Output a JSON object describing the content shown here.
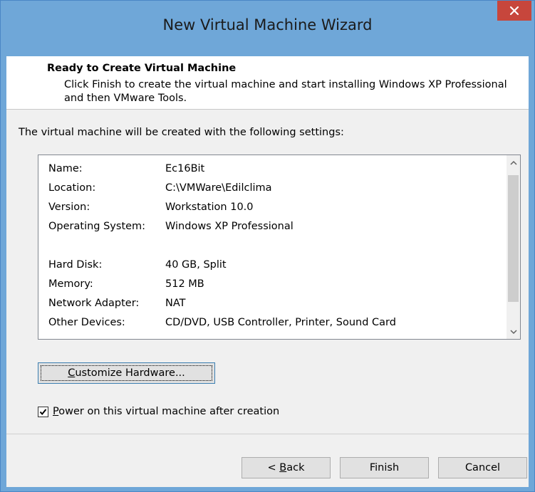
{
  "window": {
    "title": "New Virtual Machine Wizard"
  },
  "header": {
    "title": "Ready to Create Virtual Machine",
    "description": "Click Finish to create the virtual machine and start installing Windows XP Professional and then VMware Tools."
  },
  "intro_text": "The virtual machine will be created with the following settings:",
  "settings": [
    {
      "key": "Name:",
      "value": "Ec16Bit"
    },
    {
      "key": "Location:",
      "value": "C:\\VMWare\\Edilclima"
    },
    {
      "key": "Version:",
      "value": "Workstation 10.0"
    },
    {
      "key": "Operating System:",
      "value": "Windows XP Professional"
    },
    {
      "key": "Hard Disk:",
      "value": "40 GB, Split"
    },
    {
      "key": "Memory:",
      "value": "512 MB"
    },
    {
      "key": "Network Adapter:",
      "value": "NAT"
    },
    {
      "key": "Other Devices:",
      "value": "CD/DVD, USB Controller, Printer, Sound Card"
    }
  ],
  "buttons": {
    "customize_hotkey": "C",
    "customize_rest": "ustomize Hardware...",
    "back_prefix": "< ",
    "back_hotkey": "B",
    "back_rest": "ack",
    "finish": "Finish",
    "cancel": "Cancel"
  },
  "power_on": {
    "hotkey": "P",
    "rest": "ower on this virtual machine after creation",
    "checked": true
  },
  "icons": {
    "close": "close-icon",
    "scroll_up": "chevron-up-icon",
    "scroll_down": "chevron-down-icon",
    "check": "checkmark-icon"
  },
  "colors": {
    "frame": "#6fa7d8",
    "close": "#c7463c",
    "client": "#f0f0f0"
  }
}
